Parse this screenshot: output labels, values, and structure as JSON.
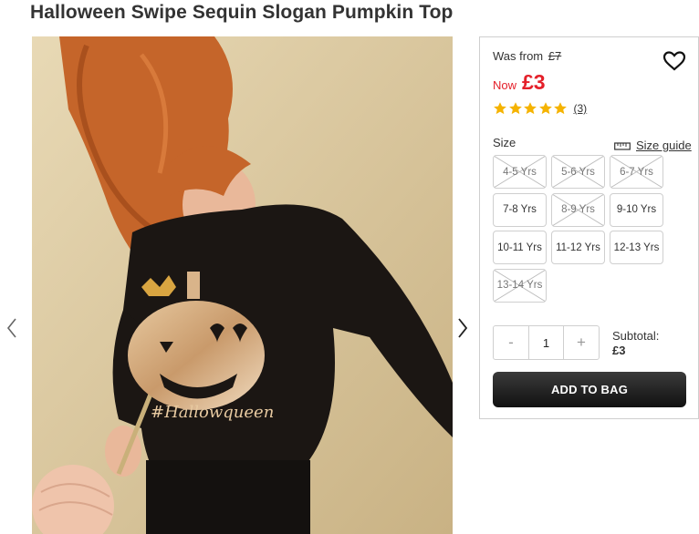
{
  "product": {
    "title": "Halloween Swipe Sequin Slogan Pumpkin Top",
    "image_alt": "Child wearing black long sleeve top with sequin pumpkin and Hallowqueen slogan",
    "image_slogan": "#Hallowqueen"
  },
  "pricing": {
    "was_label": "Was from",
    "was_price": "£7",
    "now_label": "Now",
    "now_price": "£3",
    "accent_color": "#e4202a"
  },
  "rating": {
    "stars": 5,
    "max": 5,
    "review_count": "(3)",
    "star_color": "#f5b301"
  },
  "size": {
    "label": "Size",
    "guide_label": "Size guide",
    "guide_icon": "ruler-icon",
    "options": [
      {
        "label": "4-5 Yrs",
        "available": false
      },
      {
        "label": "5-6 Yrs",
        "available": false
      },
      {
        "label": "6-7 Yrs",
        "available": false
      },
      {
        "label": "7-8 Yrs",
        "available": true
      },
      {
        "label": "8-9 Yrs",
        "available": false
      },
      {
        "label": "9-10 Yrs",
        "available": true
      },
      {
        "label": "10-11 Yrs",
        "available": true
      },
      {
        "label": "11-12 Yrs",
        "available": true
      },
      {
        "label": "12-13 Yrs",
        "available": true
      },
      {
        "label": "13-14 Yrs",
        "available": false
      }
    ]
  },
  "quantity": {
    "minus": "-",
    "value": "1",
    "plus": "+"
  },
  "subtotal": {
    "label": "Subtotal:",
    "value": "£3"
  },
  "actions": {
    "add_to_bag": "ADD TO BAG"
  },
  "icons": {
    "wishlist": "heart-icon",
    "prev": "chevron-left-icon",
    "next": "chevron-right-icon"
  }
}
